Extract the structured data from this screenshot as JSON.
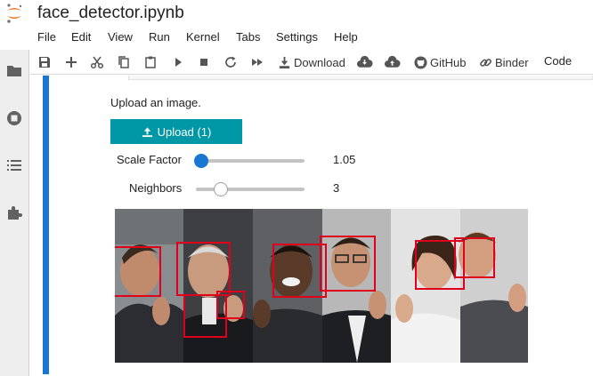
{
  "notebook": {
    "title": "face_detector.ipynb",
    "kernel": "Code"
  },
  "menu": {
    "items": [
      "File",
      "Edit",
      "View",
      "Run",
      "Kernel",
      "Tabs",
      "Settings",
      "Help"
    ]
  },
  "toolbar": {
    "buttons": [
      {
        "icon": "save-icon"
      },
      {
        "icon": "plus-icon"
      },
      {
        "icon": "scissors-icon"
      },
      {
        "icon": "copy-icon"
      },
      {
        "icon": "paste-icon"
      },
      {
        "icon": "run-icon"
      },
      {
        "icon": "stop-icon"
      },
      {
        "icon": "restart-icon"
      },
      {
        "icon": "fast-forward-icon"
      }
    ],
    "download_label": "Download",
    "github_label": "GitHub",
    "binder_label": "Binder"
  },
  "sidebar": {
    "icons": [
      "folder-icon",
      "running-icon",
      "toc-icon",
      "extension-icon"
    ]
  },
  "widget": {
    "prompt": "Upload an image.",
    "upload_label": "Upload (1)",
    "scale": {
      "label": "Scale Factor",
      "value": "1.05",
      "fraction": 0.0
    },
    "neighbors": {
      "label": "Neighbors",
      "value": "3",
      "fraction": 0.2
    }
  },
  "colors": {
    "accent": "#1976d2",
    "upload_button": "#0097a7",
    "detection_box": "#e0001b",
    "jupyter_orange": "#f37626"
  },
  "image": {
    "faces_detected": 8
  }
}
